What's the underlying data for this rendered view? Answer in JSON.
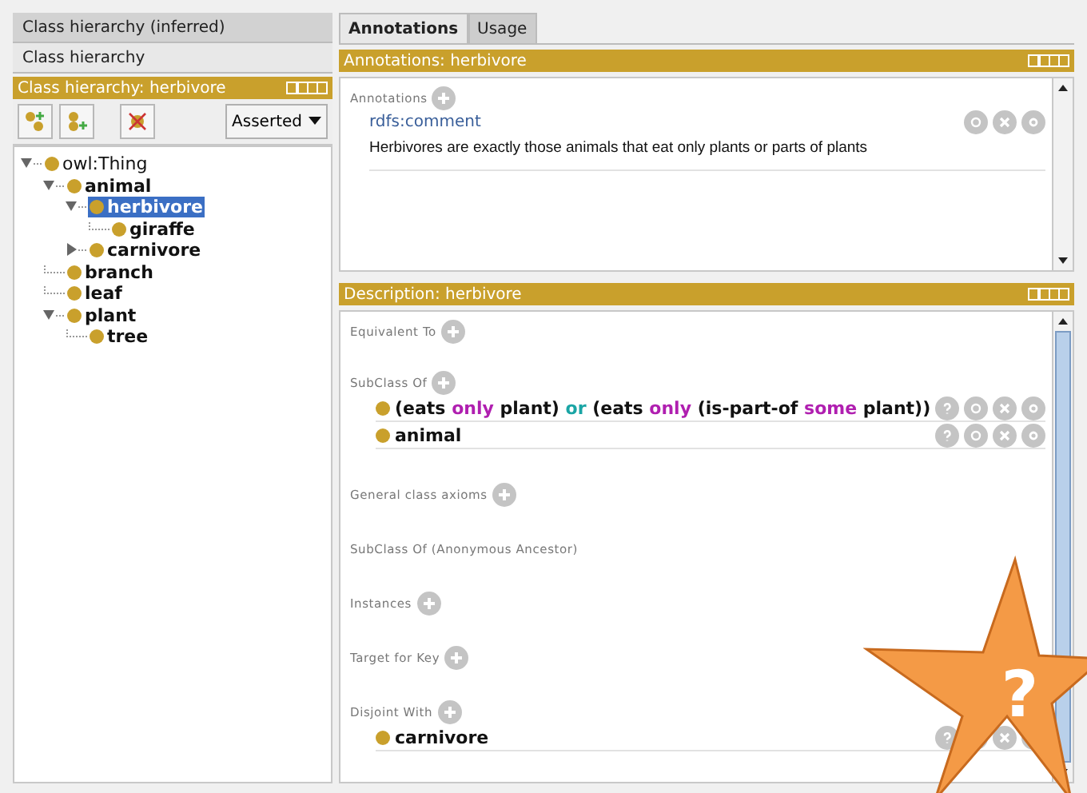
{
  "left_tabs": [
    {
      "label": "Class hierarchy (inferred)",
      "selected": false
    },
    {
      "label": "Class hierarchy",
      "selected": true
    }
  ],
  "class_view": {
    "title": "Class hierarchy: herbivore",
    "mode": "Asserted",
    "tree": [
      {
        "label": "owl:Thing",
        "bold": false,
        "expanded": true,
        "selected": false,
        "children": [
          {
            "label": "animal",
            "bold": true,
            "expanded": true,
            "selected": false,
            "children": [
              {
                "label": "herbivore",
                "bold": true,
                "expanded": true,
                "selected": true,
                "children": [
                  {
                    "label": "giraffe",
                    "bold": true,
                    "selected": false
                  }
                ]
              },
              {
                "label": "carnivore",
                "bold": true,
                "expanded": false,
                "selected": false
              }
            ]
          },
          {
            "label": "branch",
            "bold": true,
            "selected": false
          },
          {
            "label": "leaf",
            "bold": true,
            "selected": false
          },
          {
            "label": "plant",
            "bold": true,
            "expanded": true,
            "selected": false,
            "children": [
              {
                "label": "tree",
                "bold": true,
                "selected": false
              }
            ]
          }
        ]
      }
    ]
  },
  "right_tabs": [
    {
      "label": "Annotations",
      "selected": true
    },
    {
      "label": "Usage",
      "selected": false
    }
  ],
  "annotations_view": {
    "title": "Annotations: herbivore",
    "section": "Annotations",
    "items": [
      {
        "property": "rdfs:comment",
        "value": "Herbivores are exactly those animals that eat only plants or parts of plants"
      }
    ]
  },
  "description_view": {
    "title": "Description: herbivore",
    "sections": [
      {
        "label": "Equivalent To",
        "addable": true
      },
      {
        "label": "SubClass Of",
        "addable": true,
        "items": [
          {
            "tokens": [
              {
                "kind": "class",
                "text": "(eats"
              },
              {
                "kind": "keyword",
                "text": "only"
              },
              {
                "kind": "class",
                "text": "plant)"
              },
              {
                "kind": "connective",
                "text": "or"
              },
              {
                "kind": "class",
                "text": "(eats"
              },
              {
                "kind": "keyword",
                "text": "only"
              },
              {
                "kind": "class",
                "text": "(is-part-of"
              },
              {
                "kind": "keyword",
                "text": "some"
              },
              {
                "kind": "class",
                "text": "plant))"
              }
            ]
          },
          {
            "tokens": [
              {
                "kind": "class",
                "text": "animal"
              }
            ]
          }
        ]
      },
      {
        "label": "General class axioms",
        "addable": true
      },
      {
        "label": "SubClass Of (Anonymous Ancestor)",
        "addable": false
      },
      {
        "label": "Instances",
        "addable": true
      },
      {
        "label": "Target for Key",
        "addable": true
      },
      {
        "label": "Disjoint With",
        "addable": true,
        "items": [
          {
            "tokens": [
              {
                "kind": "class",
                "text": "carnivore"
              }
            ]
          }
        ]
      }
    ]
  },
  "help_star": {
    "label": "?"
  }
}
